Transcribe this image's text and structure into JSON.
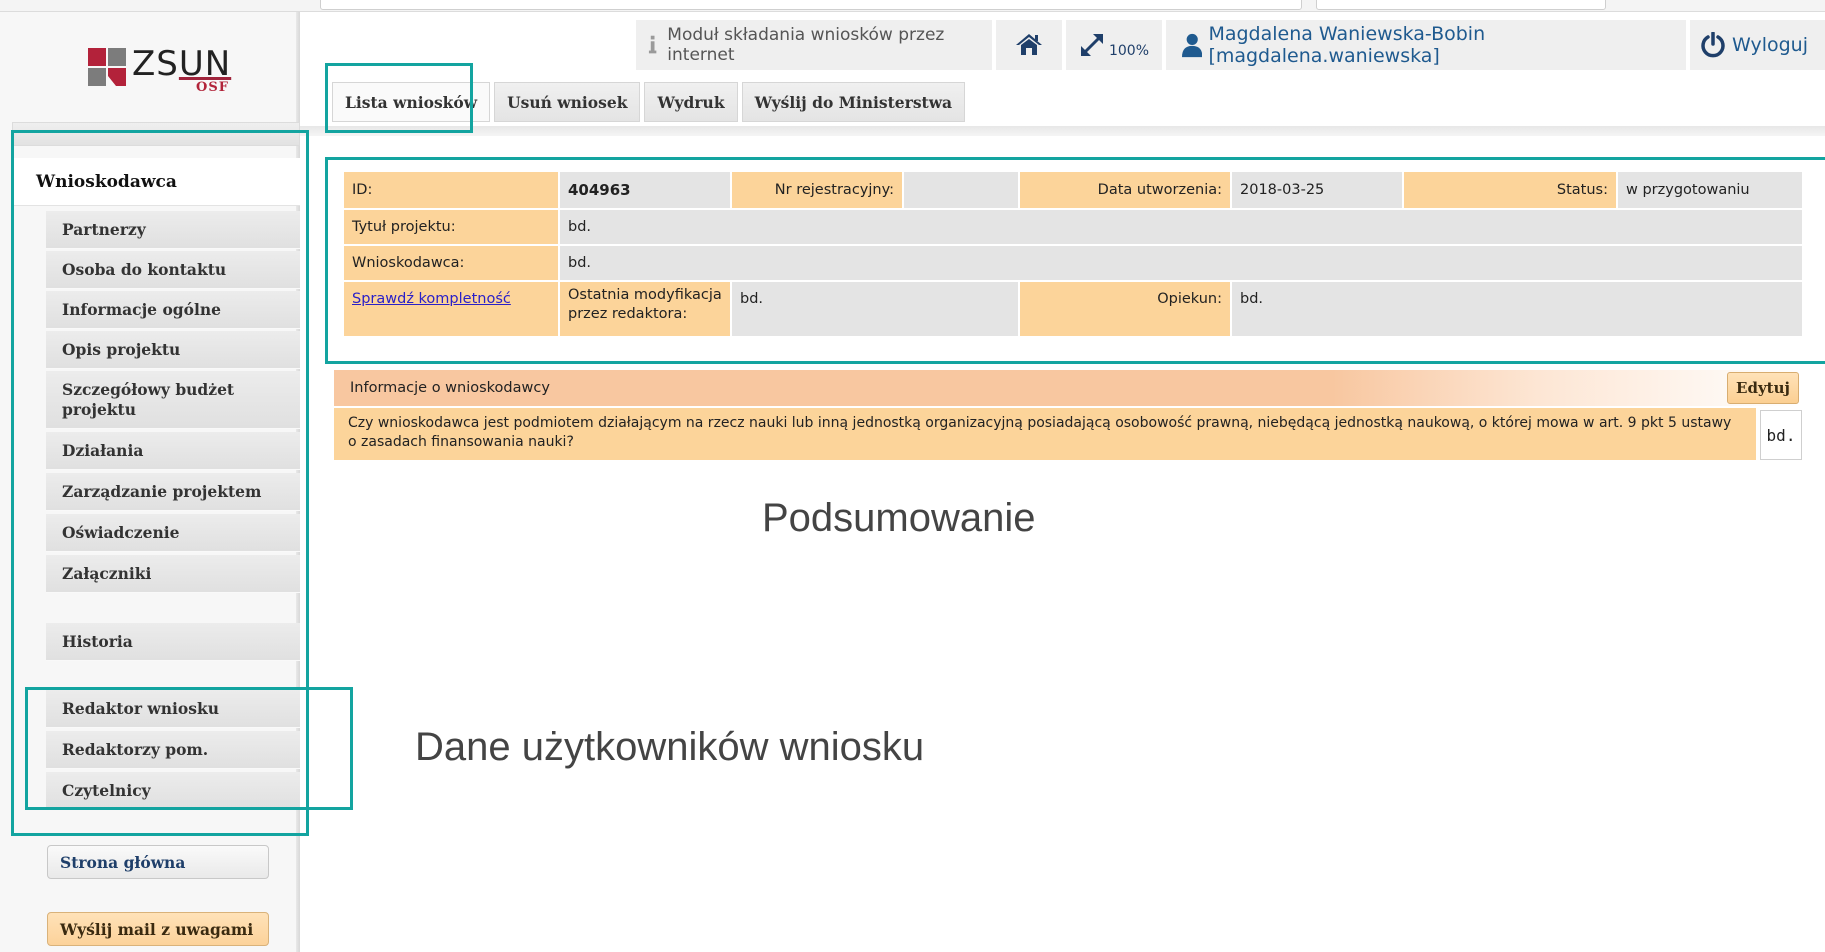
{
  "logo": {
    "text": "ZSUN",
    "sub": "OSF"
  },
  "header": {
    "module_label": "Moduł składania wniosków przez internet",
    "zoom_label": "100%",
    "user_label": "Magdalena Waniewska-Bobin [magdalena.waniewska]",
    "logout_label": "Wyloguj",
    "accent_color": "#1f5a8f"
  },
  "tabs": [
    {
      "label": "Lista wniosków"
    },
    {
      "label": "Usuń wniosek"
    },
    {
      "label": "Wydruk"
    },
    {
      "label": "Wyślij do Ministerstwa"
    }
  ],
  "sidebar": {
    "active_section": "Wnioskodawca",
    "items": [
      {
        "label": "Partnerzy"
      },
      {
        "label": "Osoba do kontaktu"
      },
      {
        "label": "Informacje ogólne"
      },
      {
        "label": "Opis projektu"
      },
      {
        "label": "Szczegółowy budżet projektu"
      },
      {
        "label": "Działania"
      },
      {
        "label": "Zarządzanie projektem"
      },
      {
        "label": "Oświadczenie"
      },
      {
        "label": "Załączniki"
      },
      {
        "label": "Historia"
      },
      {
        "label": "Redaktor wniosku"
      },
      {
        "label": "Redaktorzy pom."
      },
      {
        "label": "Czytelnicy"
      }
    ],
    "home_button": "Strona główna",
    "mail_button": "Wyślij mail z uwagami"
  },
  "application": {
    "id_label": "ID:",
    "id_value": "404963",
    "reg_label": "Nr rejestracyjny:",
    "reg_value": "",
    "created_label": "Data utworzenia:",
    "created_value": "2018-03-25",
    "status_label": "Status:",
    "status_value": "w przygotowaniu",
    "title_label": "Tytuł projektu:",
    "title_value": "bd.",
    "applicant_label": "Wnioskodawca:",
    "applicant_value": "bd.",
    "check_link": "Sprawdź kompletność",
    "last_mod_label": "Ostatnia modyfikacja przez redaktora:",
    "last_mod_value": "bd.",
    "supervisor_label": "Opiekun:",
    "supervisor_value": "bd."
  },
  "applicant_info": {
    "heading": "Informacje o wnioskodawcy",
    "edit_button": "Edytuj",
    "question": "Czy wnioskodawca jest podmiotem działającym na rzecz nauki lub inną jednostką organizacyjną posiadającą osobowość prawną, niebędącą jednostką naukową, o której mowa w art. 9 pkt 5 ustawy o zasadach finansowania nauki?",
    "answer": "bd."
  },
  "annotations": {
    "summary": "Podsumowanie",
    "users": "Dane użytkowników wniosku",
    "box_color": "#13a4a0"
  }
}
